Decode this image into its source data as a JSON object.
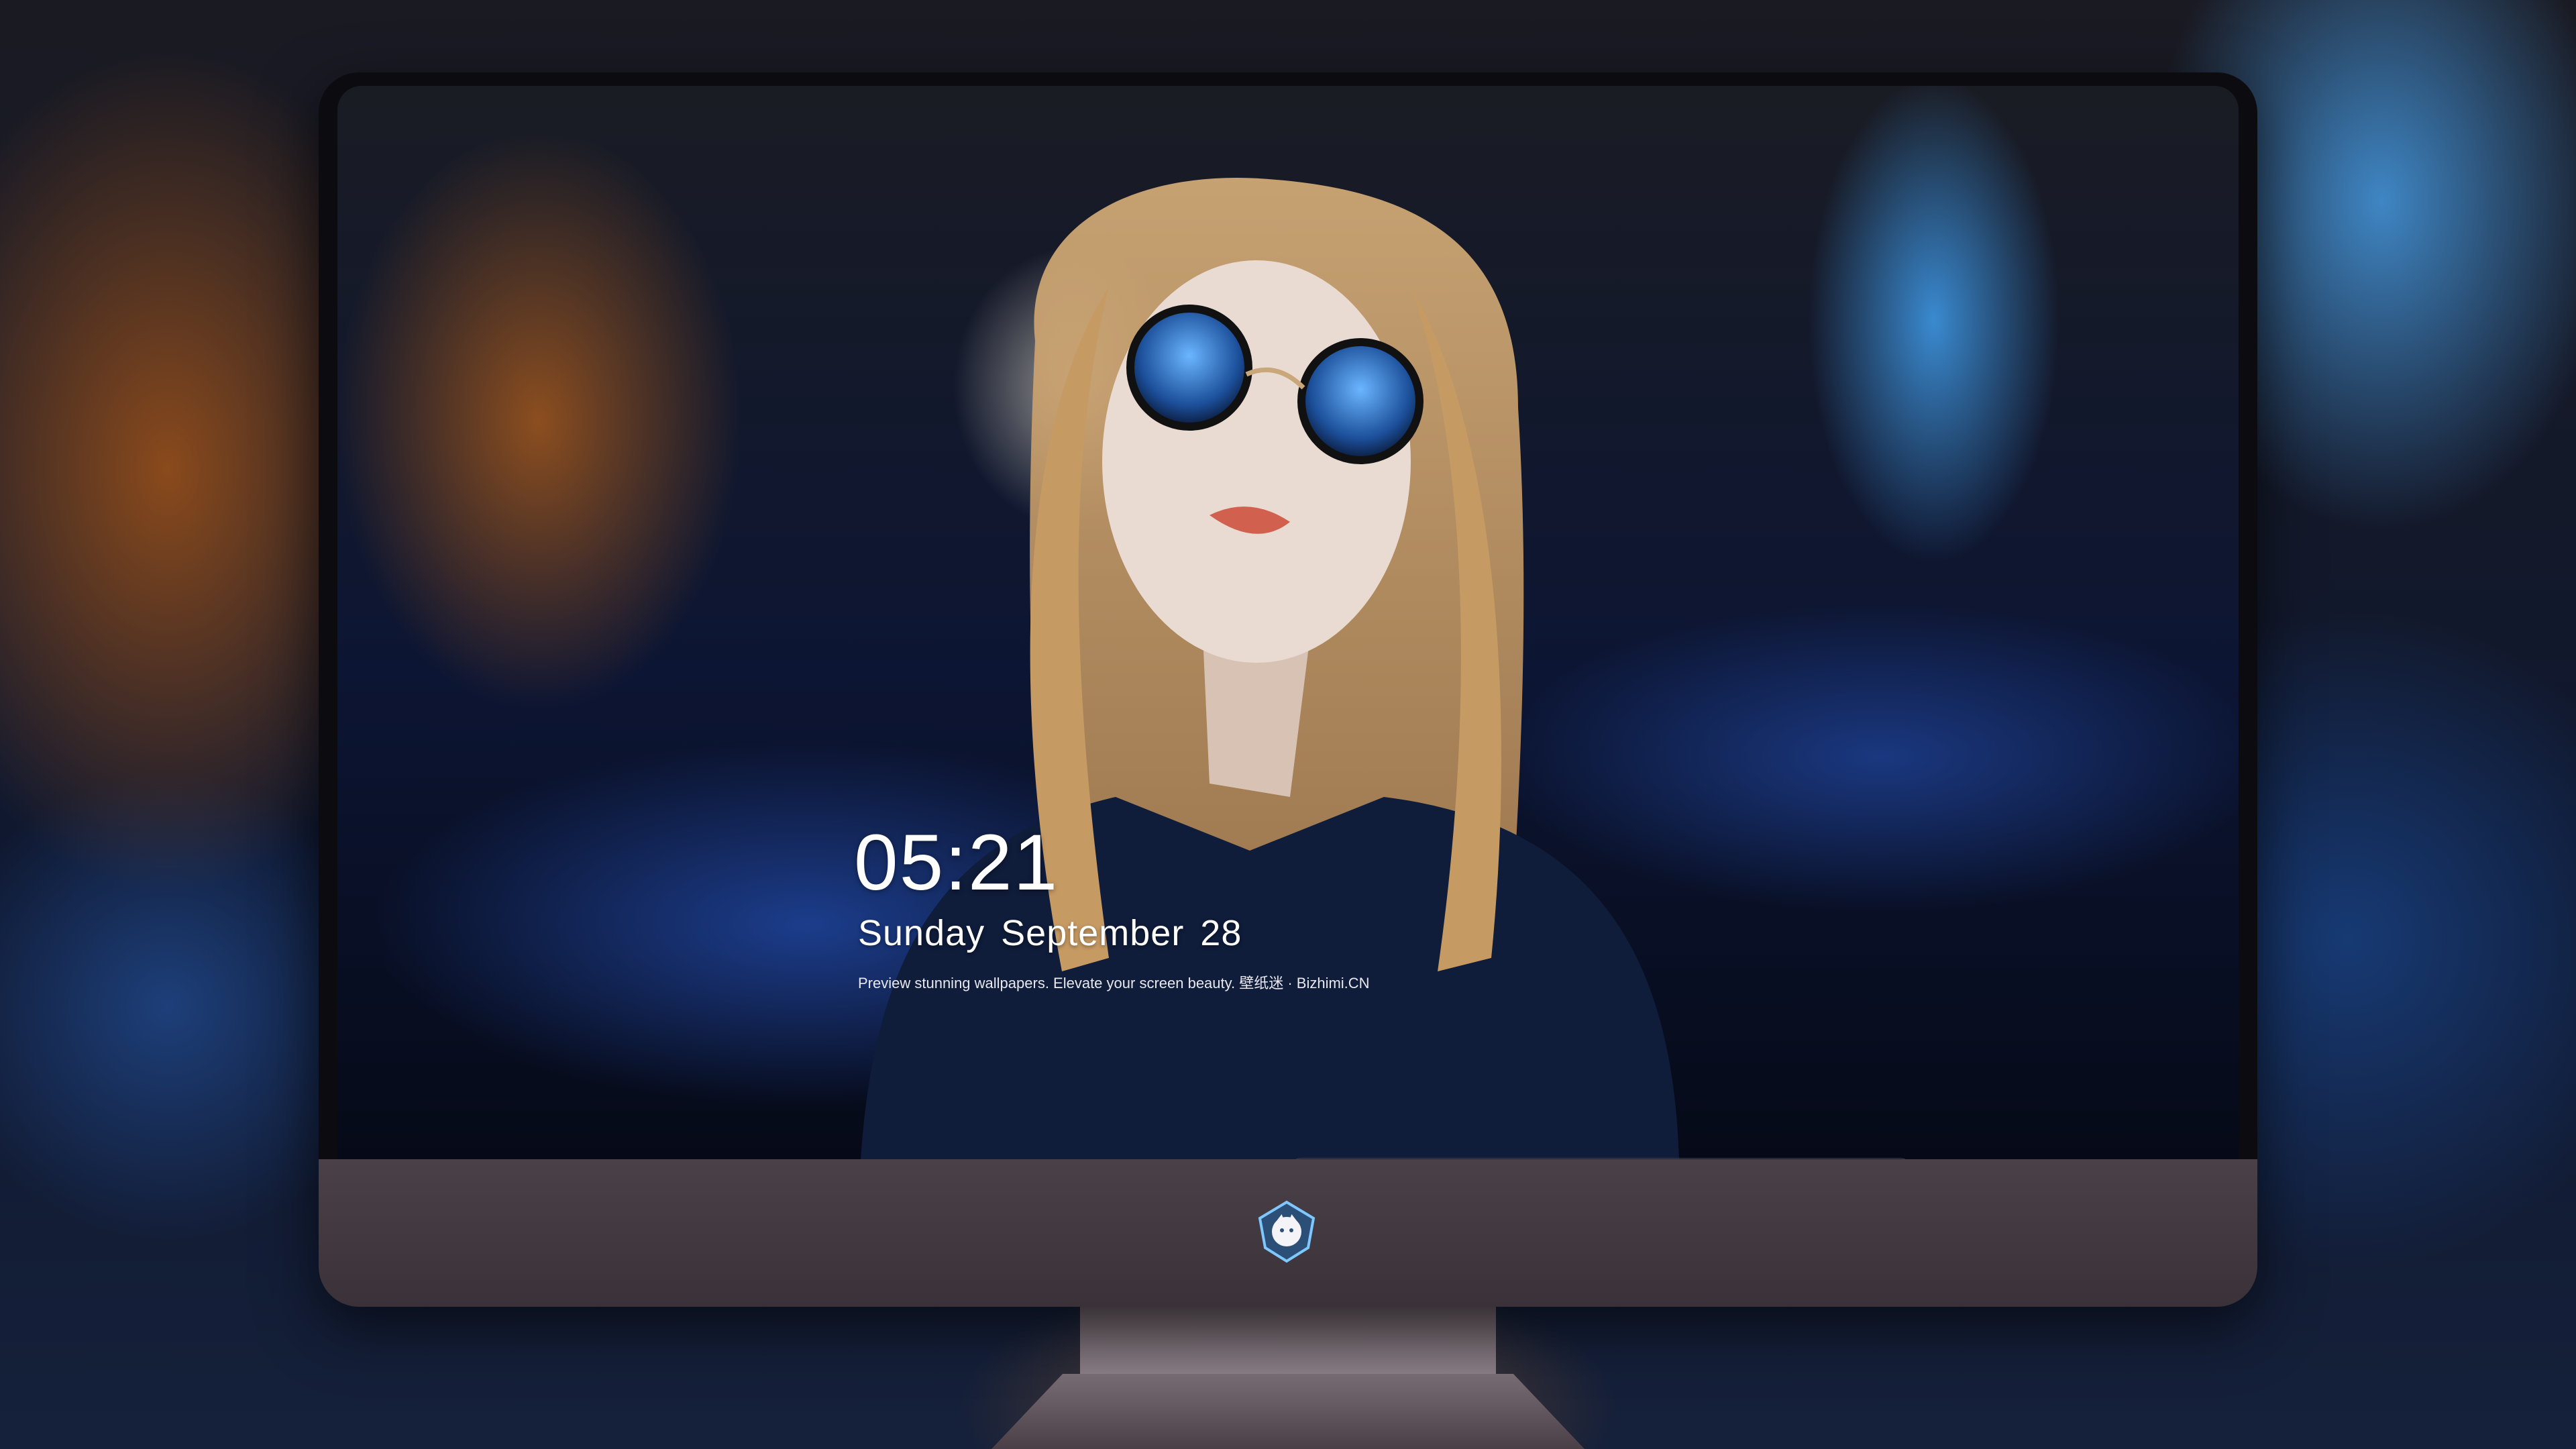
{
  "lockscreen": {
    "time": "05:21",
    "date": "Sunday September  28",
    "caption": "Preview stunning wallpapers. Elevate your screen beauty. 壁纸迷 · Bizhimi.CN"
  },
  "dock": {
    "apps": [
      {
        "name": "messages-icon",
        "color": "#34c759"
      },
      {
        "name": "weather-icon",
        "color": "#2f7de1"
      },
      {
        "name": "clock-icon",
        "color": "#f2f2f2"
      },
      {
        "name": "preview-icon",
        "color": "#e9c23a"
      },
      {
        "name": "claquette-icon",
        "color": "#4fb6d8"
      },
      {
        "name": "notes-icon",
        "color": "#f7d24a"
      },
      {
        "name": "photos-icon",
        "color": "#e46b4a"
      },
      {
        "name": "music-icon",
        "color": "#e24fd6"
      },
      {
        "name": "app-store-icon",
        "color": "#1f8ff0"
      },
      {
        "name": "camera-icon",
        "color": "#8d8d92"
      }
    ]
  },
  "colors": {
    "bezel": "#0c0c10",
    "chin": "#4a4148",
    "stand": "#7a6e76"
  }
}
